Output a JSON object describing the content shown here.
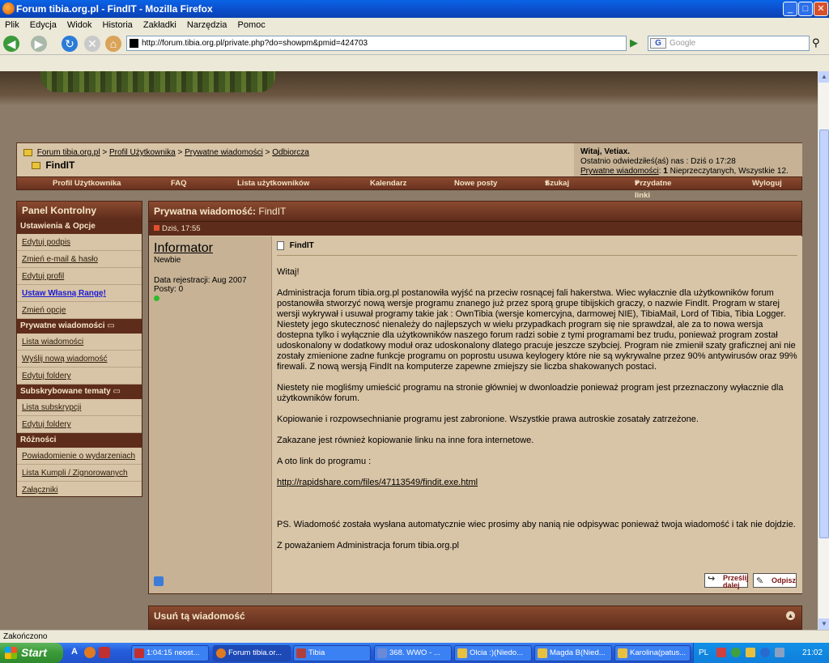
{
  "window": {
    "title": "Forum tibia.org.pl - FindIT - Mozilla Firefox"
  },
  "menu": [
    "Plik",
    "Edycja",
    "Widok",
    "Historia",
    "Zakładki",
    "Narzędzia",
    "Pomoc"
  ],
  "browser": {
    "url": "http://forum.tibia.org.pl/private.php?do=showpm&pmid=424703",
    "search_placeholder": "Google",
    "status": "Zakończono"
  },
  "breadcrumb": {
    "items": [
      "Forum tibia.org.pl",
      "Profil Użytkownika",
      "Prywatne wiadomości",
      "Odbiorcza"
    ],
    "sep": ">",
    "current": "FindIT"
  },
  "welcome": {
    "greeting": "Witaj, Vetiax.",
    "last_visit": "Ostatnio odwiedziłeś(aś) nas : Dziś o 17:28",
    "pm_link": "Prywatne wiadomości",
    "pm_stats_prefix": ": ",
    "pm_unread": "1",
    "pm_stats_suffix": " Nieprzeczytanych, Wszystkie 12."
  },
  "navrow": [
    "Profil Użytkownika",
    "FAQ",
    "Lista użytkowników",
    "Kalendarz",
    "Nowe posty",
    "Szukaj",
    "Przydatne linki",
    "Wyloguj"
  ],
  "sidebar": {
    "title": "Panel Kontrolny",
    "sections": [
      {
        "title": "Ustawienia & Opcje",
        "links": [
          "Edytuj podpis",
          "Zmień e-mail & hasło",
          "Edytuj profil",
          "Ustaw Własną Rangę!",
          "Zmień opcje"
        ]
      },
      {
        "title": "Prywatne wiadomości",
        "links": [
          "Lista wiadomości",
          "Wyślij nową wiadomość",
          "Edytuj foldery"
        ]
      },
      {
        "title": "Subskrybowane tematy",
        "links": [
          "Lista subskrypcji",
          "Edytuj foldery"
        ]
      },
      {
        "title": "Różności",
        "links": [
          "Powiadomienie o wydarzeniach",
          "Lista Kumpli / Zignorowanych",
          "Załączniki"
        ]
      }
    ]
  },
  "post": {
    "header_label": "Prywatna wiadomość:",
    "header_subject": " FindIT",
    "date": "Dziś, 17:55",
    "author": "Informator",
    "rank": "Newbie",
    "joined": "Data rejestracji: Aug 2007",
    "posts": "Posty: 0",
    "subject": "FindIT",
    "body": [
      "Witaj!",
      "Administracja forum tibia.org.pl postanowiła wyjść na przeciw rosnącej fali hakerstwa. Wiec wyłacznie dla użytkowników forum postanowiła stworzyć nową wersje programu znanego już przez sporą grupe tibijskich graczy, o nazwie FindIt. Program w starej wersji wykrywał i usuwał programy takie jak : OwnTibia (wersje komercyjna, darmowej NIE), TibiaMail, Lord of Tibia, Tibia Logger. Niestety jego skutecznosć nienależy do najlepszych w wielu przypadkach program się nie sprawdzał, ale za to nowa wersja dostepna tylko i wyłącznie dla użytkowników naszego forum radzi sobie z tymi programami bez trudu, ponieważ program został udoskonalony w dodatkowy moduł oraz udoskonalony dlatego pracuje jeszcze szybciej. Program nie zmienił szaty graficznej ani nie zostały zmienione zadne funkcje programu on poprostu usuwa keylogery które nie są wykrywalne przez 90% antywirusów oraz 99% firewali. Z nową wersją FindIt na komputerze zapewne zmiejszy sie liczba shakowanych postaci.",
      "Niestety nie mogliśmy umieścić programu na stronie główniej w dwonloadzie ponieważ program jest przeznaczony wyłacznie dla użytkowników forum.",
      "Kopiowanie i rozpowsechnianie programu jest zabronione. Wszystkie prawa autroskie zosatały zatrzeżone.",
      "Zakazane jest również kopiowanie linku na inne fora internetowe.",
      "A oto link do programu :"
    ],
    "link": "http://rapidshare.com/files/47113549/findit.exe.html",
    "ps": "PS. Wiadomość została wysłana automatycznie wiec prosimy aby nanią nie odpisywac ponieważ twoja wiadomość i tak nie dojdzie.",
    "signature": "Z poważaniem Administracja forum tibia.org.pl",
    "forward_label": "Prześlij dalej",
    "reply_label": "Odpisz"
  },
  "delete_box": {
    "title": "Usuń tą wiadomość"
  },
  "taskbar": {
    "start": "Start",
    "items": [
      "1:04:15 neost...",
      "Forum tibia.or...",
      "Tibia",
      "368. WWO - ...",
      "Olcia :)(Niedo...",
      "Magda B(Nied...",
      "Karolina(patus..."
    ],
    "lang": "PL",
    "clock": "21:02"
  }
}
